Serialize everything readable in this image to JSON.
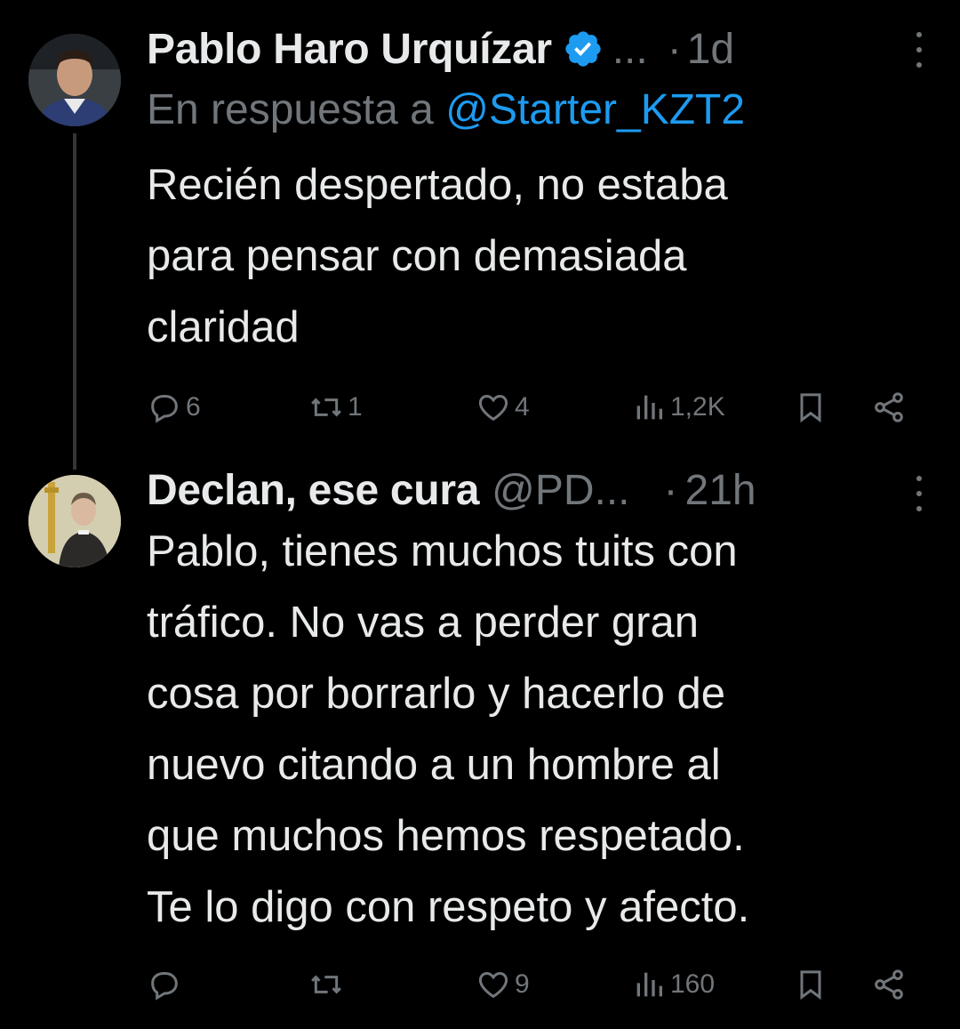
{
  "tweets": [
    {
      "name": "Pablo Haro Urquízar",
      "ellipsis": "...",
      "separator": "·",
      "time": "1d",
      "reply_to_prefix": "En respuesta a ",
      "reply_to_mention": "@Starter_KZT2",
      "text": "Recién despertado, no estaba\npara pensar con demasiada\nclaridad",
      "actions": {
        "replies": "6",
        "reposts": "1",
        "likes": "4",
        "views": "1,2K"
      },
      "verified": true
    },
    {
      "name": "Declan, ese cura",
      "handle": "@PD...",
      "separator": "·",
      "time": "21h",
      "text": "Pablo, tienes muchos tuits con\ntráfico. No vas a perder gran\ncosa por borrarlo y hacerlo de\nnuevo citando a un hombre al\nque muchos hemos respetado.\nTe lo digo con respeto y afecto.",
      "actions": {
        "replies": "",
        "reposts": "",
        "likes": "9",
        "views": "160"
      }
    }
  ],
  "colors": {
    "background": "#000000",
    "text_primary": "#e7e9ea",
    "text_secondary": "#71767b",
    "accent": "#1d9bf0",
    "thread_line": "#333639"
  },
  "icons": [
    "verified-badge-icon",
    "more-options-icon",
    "reply-icon",
    "repost-icon",
    "like-icon",
    "views-icon",
    "bookmark-icon",
    "share-icon"
  ]
}
